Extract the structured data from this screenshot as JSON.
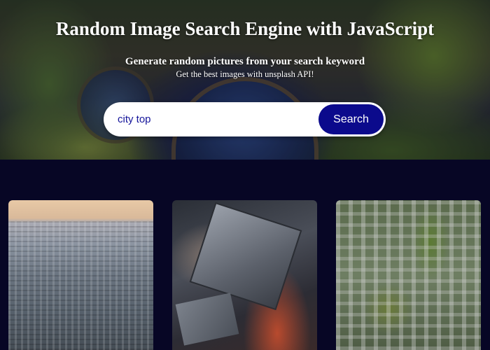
{
  "header": {
    "title": "Random Image Search Engine with JavaScript",
    "subtitle": "Generate random pictures from your search keyword",
    "tagline": "Get the best images with unsplash API!"
  },
  "search": {
    "value": "city top",
    "button_label": "Search"
  },
  "results": {
    "images": [
      {
        "subject": "city-skyline-photo"
      },
      {
        "subject": "aerial-city-street-photo"
      },
      {
        "subject": "aerial-city-grid-photo"
      }
    ]
  },
  "colors": {
    "accent": "#0b0a8c",
    "page_background": "#070625",
    "input_text": "#14149a"
  }
}
